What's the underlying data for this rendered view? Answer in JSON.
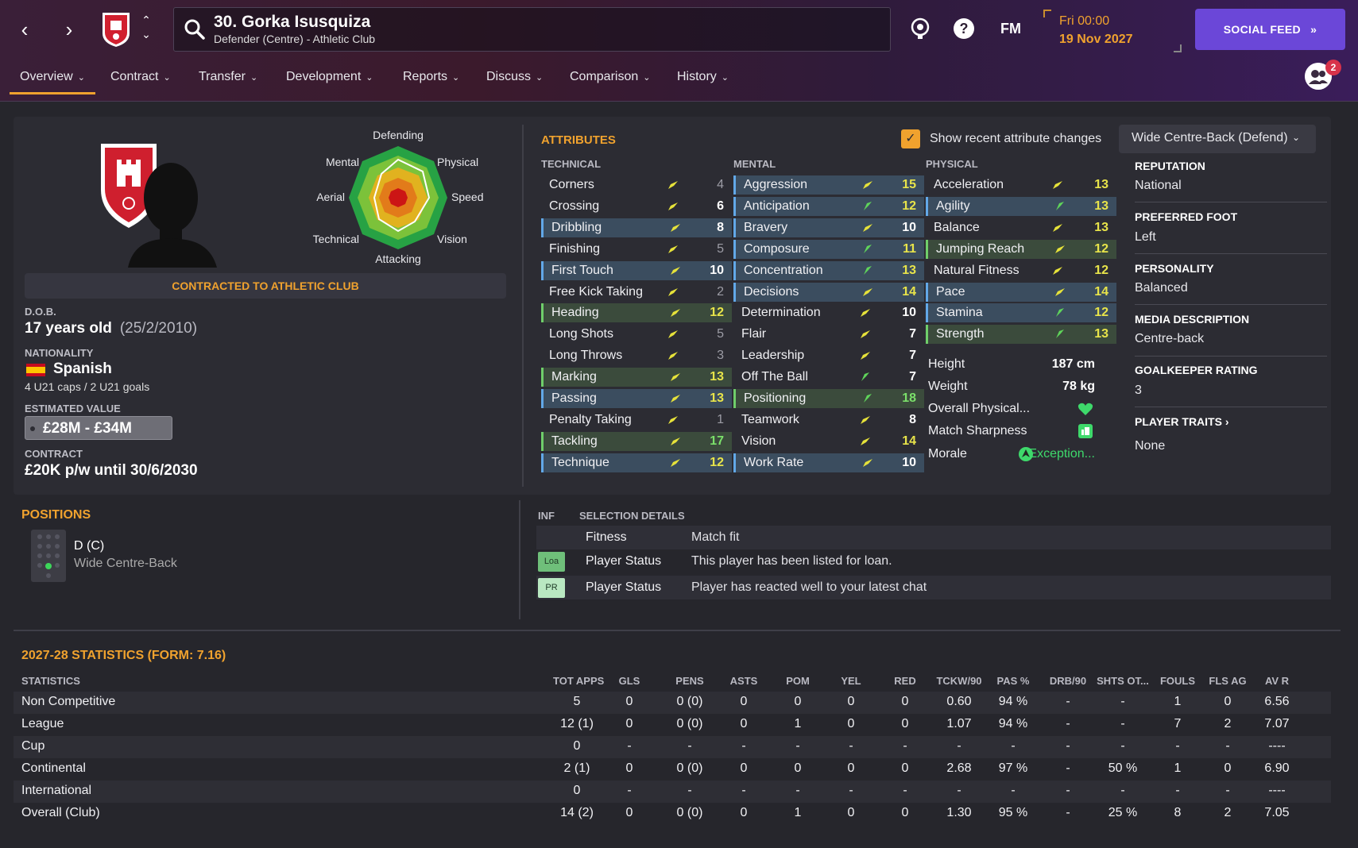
{
  "header": {
    "player_title": "30. Gorka Isusquiza",
    "player_subtitle": "Defender (Centre) - Athletic Club",
    "fm_label": "FM",
    "date_day": "Fri 00:00",
    "date_full": "19 Nov 2027",
    "social_feed_label": "SOCIAL FEED",
    "notification_count": "2"
  },
  "tabs": [
    {
      "label": "Overview"
    },
    {
      "label": "Contract"
    },
    {
      "label": "Transfer"
    },
    {
      "label": "Development"
    },
    {
      "label": "Reports"
    },
    {
      "label": "Discuss"
    },
    {
      "label": "Comparison"
    },
    {
      "label": "History"
    }
  ],
  "radar": {
    "labels": [
      "Defending",
      "Physical",
      "Speed",
      "Vision",
      "Attacking",
      "Technical",
      "Aerial",
      "Mental"
    ]
  },
  "profile": {
    "contracted_label": "CONTRACTED TO ATHLETIC CLUB",
    "dob_label": "D.O.B.",
    "age": "17 years old",
    "dob": "(25/2/2010)",
    "nationality_label": "NATIONALITY",
    "nationality": "Spanish",
    "caps": "4 U21 caps / 2 U21 goals",
    "value_label": "ESTIMATED VALUE",
    "value": "£28M - £34M",
    "contract_label": "CONTRACT",
    "contract": "£20K p/w until 30/6/2030"
  },
  "attributes": {
    "title": "ATTRIBUTES",
    "show_changes_label": "Show recent attribute changes",
    "role_select": "Wide Centre-Back (Defend)",
    "technical_label": "TECHNICAL",
    "mental_label": "MENTAL",
    "physical_label": "PHYSICAL",
    "technical": [
      {
        "name": "Corners",
        "value": "4"
      },
      {
        "name": "Crossing",
        "value": "6"
      },
      {
        "name": "Dribbling",
        "value": "8"
      },
      {
        "name": "Finishing",
        "value": "5"
      },
      {
        "name": "First Touch",
        "value": "10"
      },
      {
        "name": "Free Kick Taking",
        "value": "2"
      },
      {
        "name": "Heading",
        "value": "12"
      },
      {
        "name": "Long Shots",
        "value": "5"
      },
      {
        "name": "Long Throws",
        "value": "3"
      },
      {
        "name": "Marking",
        "value": "13"
      },
      {
        "name": "Passing",
        "value": "13"
      },
      {
        "name": "Penalty Taking",
        "value": "1"
      },
      {
        "name": "Tackling",
        "value": "17"
      },
      {
        "name": "Technique",
        "value": "12"
      }
    ],
    "mental": [
      {
        "name": "Aggression",
        "value": "15"
      },
      {
        "name": "Anticipation",
        "value": "12"
      },
      {
        "name": "Bravery",
        "value": "10"
      },
      {
        "name": "Composure",
        "value": "11"
      },
      {
        "name": "Concentration",
        "value": "13"
      },
      {
        "name": "Decisions",
        "value": "14"
      },
      {
        "name": "Determination",
        "value": "10"
      },
      {
        "name": "Flair",
        "value": "7"
      },
      {
        "name": "Leadership",
        "value": "7"
      },
      {
        "name": "Off The Ball",
        "value": "7"
      },
      {
        "name": "Positioning",
        "value": "18"
      },
      {
        "name": "Teamwork",
        "value": "8"
      },
      {
        "name": "Vision",
        "value": "14"
      },
      {
        "name": "Work Rate",
        "value": "10"
      }
    ],
    "physical": [
      {
        "name": "Acceleration",
        "value": "13"
      },
      {
        "name": "Agility",
        "value": "13"
      },
      {
        "name": "Balance",
        "value": "13"
      },
      {
        "name": "Jumping Reach",
        "value": "12"
      },
      {
        "name": "Natural Fitness",
        "value": "12"
      },
      {
        "name": "Pace",
        "value": "14"
      },
      {
        "name": "Stamina",
        "value": "12"
      },
      {
        "name": "Strength",
        "value": "13"
      }
    ],
    "height_label": "Height",
    "height": "187 cm",
    "weight_label": "Weight",
    "weight": "78 kg",
    "overall_physical_label": "Overall Physical...",
    "match_sharpness_label": "Match Sharpness",
    "morale_label": "Morale",
    "morale": "Exception..."
  },
  "info": {
    "reputation_label": "REPUTATION",
    "reputation": "National",
    "foot_label": "PREFERRED FOOT",
    "foot": "Left",
    "personality_label": "PERSONALITY",
    "personality": "Balanced",
    "media_label": "MEDIA DESCRIPTION",
    "media": "Centre-back",
    "gk_label": "GOALKEEPER RATING",
    "gk": "3",
    "traits_label": "PLAYER TRAITS",
    "traits": "None"
  },
  "positions": {
    "title": "POSITIONS",
    "code": "D (C)",
    "role": "Wide Centre-Back"
  },
  "selection": {
    "inf_label": "INF",
    "title": "SELECTION DETAILS",
    "rows": [
      {
        "badge": "",
        "key": "Fitness",
        "value": "Match fit"
      },
      {
        "badge": "Loa",
        "key": "Player Status",
        "value": "This player has been listed for loan."
      },
      {
        "badge": "PR",
        "key": "Player Status",
        "value": "Player has reacted well to your latest chat"
      }
    ]
  },
  "stats": {
    "title": "2027-28 STATISTICS (FORM: 7.16)",
    "columns": [
      "STATISTICS",
      "TOT APPS",
      "GLS",
      "PENS",
      "ASTS",
      "POM",
      "YEL",
      "RED",
      "TCKW/90",
      "PAS %",
      "DRB/90",
      "SHTS OT...",
      "FOULS",
      "FLS AG",
      "AV R"
    ],
    "rows": [
      {
        "name": "Non Competitive",
        "cells": [
          "5",
          "0",
          "0 (0)",
          "0",
          "0",
          "0",
          "0",
          "0.60",
          "94 %",
          "-",
          "-",
          "1",
          "0",
          "6.56"
        ]
      },
      {
        "name": "League",
        "cells": [
          "12 (1)",
          "0",
          "0 (0)",
          "0",
          "1",
          "0",
          "0",
          "1.07",
          "94 %",
          "-",
          "-",
          "7",
          "2",
          "7.07"
        ]
      },
      {
        "name": "Cup",
        "cells": [
          "0",
          "-",
          "-",
          "-",
          "-",
          "-",
          "-",
          "-",
          "-",
          "-",
          "-",
          "-",
          "-",
          "----"
        ]
      },
      {
        "name": "Continental",
        "cells": [
          "2 (1)",
          "0",
          "0 (0)",
          "0",
          "0",
          "0",
          "0",
          "2.68",
          "97 %",
          "-",
          "50 %",
          "1",
          "0",
          "6.90"
        ]
      },
      {
        "name": "International",
        "cells": [
          "0",
          "-",
          "-",
          "-",
          "-",
          "-",
          "-",
          "-",
          "-",
          "-",
          "-",
          "-",
          "-",
          "----"
        ]
      },
      {
        "name": "Overall (Club)",
        "cells": [
          "14 (2)",
          "0",
          "0 (0)",
          "0",
          "1",
          "0",
          "0",
          "1.30",
          "95 %",
          "-",
          "25 %",
          "8",
          "2",
          "7.05"
        ]
      }
    ]
  },
  "colors": {
    "accent": "#f0a22e",
    "social": "#6b47d8",
    "highlight_blue": "#3b4d5f",
    "highlight_green": "#3b4b3c"
  }
}
